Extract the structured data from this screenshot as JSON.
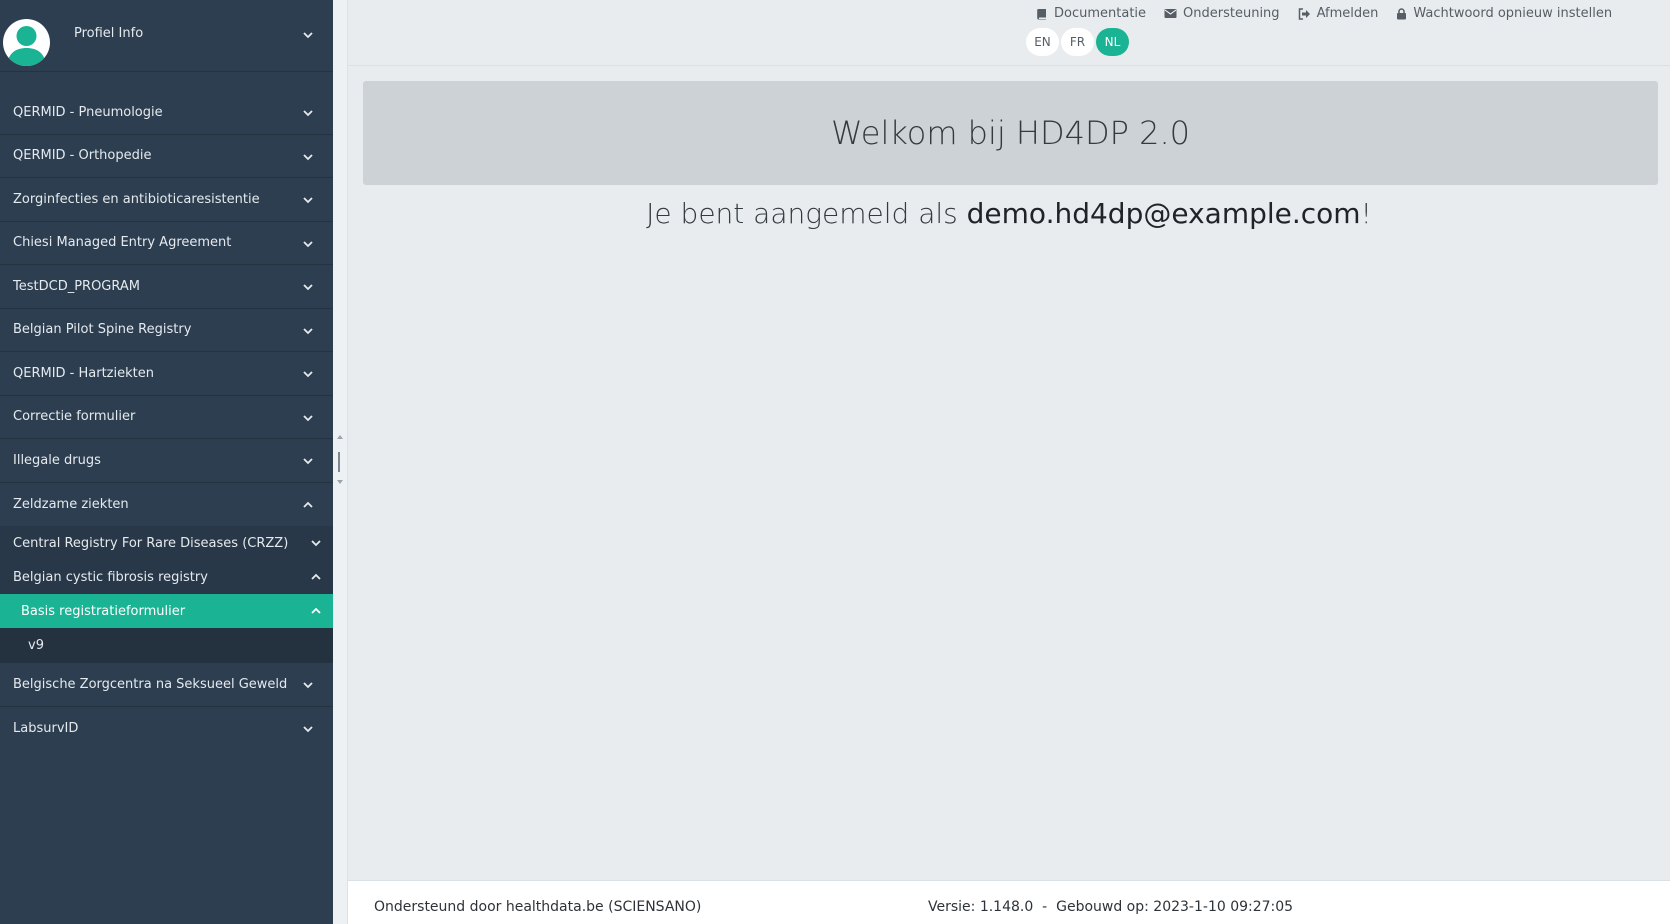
{
  "sidebar": {
    "profile_label": "Profiel Info",
    "items": [
      {
        "label": "QERMID - Pneumologie"
      },
      {
        "label": "QERMID - Orthopedie"
      },
      {
        "label": "Zorginfecties en antibioticaresistentie"
      },
      {
        "label": "Chiesi Managed Entry Agreement"
      },
      {
        "label": "TestDCD_PROGRAM"
      },
      {
        "label": "Belgian Pilot Spine Registry"
      },
      {
        "label": "QERMID - Hartziekten"
      },
      {
        "label": "Correctie formulier"
      },
      {
        "label": "Illegale drugs"
      },
      {
        "label": "Zeldzame ziekten"
      }
    ],
    "sub_items": [
      {
        "label": "Central Registry For Rare Diseases (CRZZ)"
      },
      {
        "label": "Belgian cystic fibrosis registry"
      }
    ],
    "active_item": {
      "label": "Basis registratieformulier"
    },
    "version_item": {
      "label": "v9"
    },
    "items_after": [
      {
        "label": "Belgische Zorgcentra na Seksueel Geweld"
      },
      {
        "label": "LabsurvID"
      }
    ]
  },
  "topbar": {
    "links": [
      {
        "label": "Documentatie",
        "icon": "book-icon"
      },
      {
        "label": "Ondersteuning",
        "icon": "envelope-icon"
      },
      {
        "label": "Afmelden",
        "icon": "sign-out-icon"
      },
      {
        "label": "Wachtwoord opnieuw instellen",
        "icon": "lock-icon"
      }
    ],
    "languages": [
      "EN",
      "FR",
      "NL"
    ],
    "active_language": "NL"
  },
  "main": {
    "welcome_title": "Welkom bij HD4DP 2.0",
    "logged_in_prefix": "Je bent aangemeld als ",
    "logged_in_email": "demo.hd4dp@example.com",
    "logged_in_suffix": "!"
  },
  "footer": {
    "supported_by": "Ondersteund door healthdata.be (SCIENSANO)",
    "version": "Versie: 1.148.0  -  Gebouwd op: 2023-1-10 09:27:05"
  },
  "colors": {
    "sidebar_bg": "#2d3e50",
    "accent": "#1ab394"
  }
}
